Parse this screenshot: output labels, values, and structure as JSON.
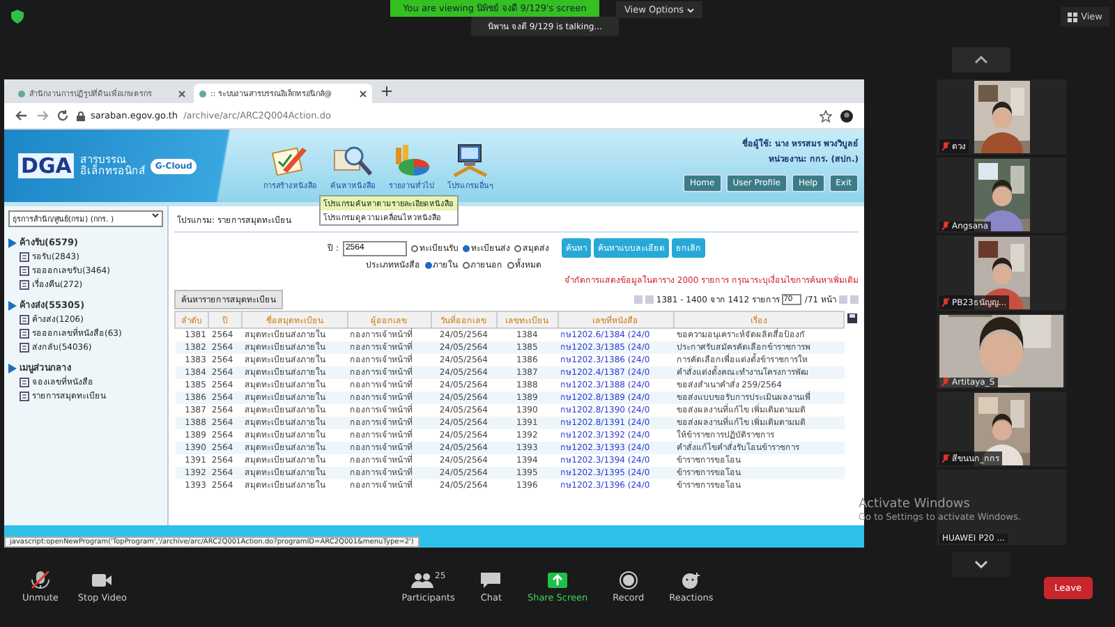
{
  "meeting": {
    "banner": "You are viewing นิพิชย์ จงดี 9/129's screen",
    "view_options": "View Options",
    "talking": "นิพาน จงดี 9/129 is talking...",
    "view_button": "View"
  },
  "browser": {
    "tabs": [
      {
        "title": "สำนักงานการปฏิรูปที่ดินเพื่อเกษตรกร",
        "selected": false
      },
      {
        "title": ":: ระบบงานสารบรรณอิเล็กทรอนิกส์@",
        "selected": true
      }
    ],
    "url_host": "saraban.egov.go.th",
    "url_path": "/archive/arc/ARC2Q004Action.do",
    "status_text": "javascript:openNewProgram('TopProgram','/archive/arc/ARC2Q001Action.do?programID=ARC2Q001&menuType=2')"
  },
  "app": {
    "logo": {
      "brand": "DGA",
      "line1": "สารบรรณ",
      "line2": "อิเล็กทรอนิกส์",
      "cloud": "G-Cloud"
    },
    "menu": [
      {
        "label": "การสร้างหนังสือ",
        "kind": "create"
      },
      {
        "label": "ค้นหาหนังสือ",
        "kind": "search"
      },
      {
        "label": "รายงานทั่วไป",
        "kind": "report"
      },
      {
        "label": "โปรแกรมอื่นๆ",
        "kind": "other"
      }
    ],
    "user": "ชื่อผู้ใช้: นาง หรรสมร พวงวิบูลย์",
    "unit": "หน่วยงาน: กกร. (สปก.)",
    "top_buttons": [
      "Home",
      "User Profile",
      "Help",
      "Exit"
    ],
    "dropdown": [
      {
        "label": "โปรแกรมค้นหาตามรายละเอียดหนังสือ",
        "selected": true
      },
      {
        "label": "โปรแกรมดูความเคลื่อนไหวหนังสือ",
        "selected": false
      }
    ],
    "department": "ธุรการสำนัก/ศูนย์(กรม) (กกร. )",
    "tree": [
      {
        "label": "ค้างรับ(6579)",
        "children": [
          {
            "label": "รอรับ(2843)"
          },
          {
            "label": "รอออกเลขรับ(3464)"
          },
          {
            "label": "เรื่องคืน(272)"
          }
        ]
      },
      {
        "label": "ค้างส่ง(55305)",
        "children": [
          {
            "label": "ค้างส่ง(1206)"
          },
          {
            "label": "รอออกเลขที่หนังสือ(63)"
          },
          {
            "label": "ส่งกลับ(54036)"
          }
        ]
      },
      {
        "label": "เมนูส่วนกลาง",
        "children": [
          {
            "label": "จองเลขที่หนังสือ"
          },
          {
            "label": "รายการสมุดทะเบียน"
          }
        ]
      }
    ],
    "program_title": "โปรแกรม: รายการสมุดทะเบียน",
    "form": {
      "year_label": "ปี :",
      "year_value": "2564",
      "register_types": [
        {
          "label": "ทะเบียนรับ",
          "selected": false
        },
        {
          "label": "ทะเบียนส่ง",
          "selected": true
        },
        {
          "label": "สมุดส่ง",
          "selected": false
        }
      ],
      "buttons": [
        "ค้นหา",
        "ค้นหาแบบละเอียด",
        "ยกเลิก"
      ],
      "doc_type_label": "ประเภทหนังสือ",
      "doc_types": [
        {
          "label": "ภายใน",
          "selected": true
        },
        {
          "label": "ภายนอก",
          "selected": false
        },
        {
          "label": "ทั้งหมด",
          "selected": false
        }
      ],
      "notice": "จำกัดการแสดงข้อมูลในตาราง 2000 รายการ กรุณาระบุเงื่อนไขการค้นหาเพิ่มเติม"
    },
    "grid": {
      "caption": "ค้นหารายการสมุดทะเบียน",
      "pager": "1381 - 1400 จาก 1412 รายการ",
      "page": "70",
      "page_total": "/71 หน้า",
      "columns": [
        "ลำดับ",
        "ปี",
        "ชื่อสมุดทะเบียน",
        "ผู้ออกเลข",
        "วันที่ออกเลข",
        "เลขทะเบียน",
        "เลขที่หนังสือ",
        "เรื่อง"
      ],
      "rows": [
        [
          "1381",
          "2564",
          "สมุดทะเบียนส่งภายใน",
          "กองการเจ้าหน้าที่",
          "24/05/2564",
          "1384",
          "กษ1202.6/1384 (24/0",
          "ขอความอนุเคราะห์จัดผลิตสื่อป้องกั"
        ],
        [
          "1382",
          "2564",
          "สมุดทะเบียนส่งภายใน",
          "กองการเจ้าหน้าที่",
          "24/05/2564",
          "1385",
          "กษ1202.3/1385 (24/0",
          "ประกาศรับสมัครคัดเลือกข้าราชการพ"
        ],
        [
          "1383",
          "2564",
          "สมุดทะเบียนส่งภายใน",
          "กองการเจ้าหน้าที่",
          "24/05/2564",
          "1386",
          "กษ1202.3/1386 (24/0",
          "การคัดเลือกเพื่อแต่งตั้งข้าราชการให"
        ],
        [
          "1384",
          "2564",
          "สมุดทะเบียนส่งภายใน",
          "กองการเจ้าหน้าที่",
          "24/05/2564",
          "1387",
          "กษ1202.4/1387 (24/0",
          "คำสั่งแต่งตั้งคณะทำงานโครงการพัฒ"
        ],
        [
          "1385",
          "2564",
          "สมุดทะเบียนส่งภายใน",
          "กองการเจ้าหน้าที่",
          "24/05/2564",
          "1388",
          "กษ1202.3/1388 (24/0",
          "ขอส่งสำเนาคำสั่ง 259/2564"
        ],
        [
          "1386",
          "2564",
          "สมุดทะเบียนส่งภายใน",
          "กองการเจ้าหน้าที่",
          "24/05/2564",
          "1389",
          "กษ1202.8/1389 (24/0",
          "ขอส่งแบบขอรับการประเมินผลงานเพื่"
        ],
        [
          "1387",
          "2564",
          "สมุดทะเบียนส่งภายใน",
          "กองการเจ้าหน้าที่",
          "24/05/2564",
          "1390",
          "กษ1202.8/1390 (24/0",
          "ขอส่งผลงานที่แก้ไข เพิ่มเติมตามมติ"
        ],
        [
          "1388",
          "2564",
          "สมุดทะเบียนส่งภายใน",
          "กองการเจ้าหน้าที่",
          "24/05/2564",
          "1391",
          "กษ1202.8/1391 (24/0",
          "ขอส่งผลงานที่แก้ไข เพิ่มเติมตามมติ"
        ],
        [
          "1389",
          "2564",
          "สมุดทะเบียนส่งภายใน",
          "กองการเจ้าหน้าที่",
          "24/05/2564",
          "1392",
          "กษ1202.3/1392 (24/0",
          "ให้ข้าราชการปฏิบัติราชการ"
        ],
        [
          "1390",
          "2564",
          "สมุดทะเบียนส่งภายใน",
          "กองการเจ้าหน้าที่",
          "24/05/2564",
          "1393",
          "กษ1202.3/1393 (24/0",
          "คำสั่งแก้ไขคำสั่งรับโอนข้าราชการ"
        ],
        [
          "1391",
          "2564",
          "สมุดทะเบียนส่งภายใน",
          "กองการเจ้าหน้าที่",
          "24/05/2564",
          "1394",
          "กษ1202.3/1394 (24/0",
          "ข้าราชการขอโอน"
        ],
        [
          "1392",
          "2564",
          "สมุดทะเบียนส่งภายใน",
          "กองการเจ้าหน้าที่",
          "24/05/2564",
          "1395",
          "กษ1202.3/1395 (24/0",
          "ข้าราชการขอโอน"
        ],
        [
          "1393",
          "2564",
          "สมุดทะเบียนส่งภายใน",
          "กองการเจ้าหน้าที่",
          "24/05/2564",
          "1396",
          "กษ1202.3/1396 (24/0",
          "ข้าราชการขอโอน"
        ]
      ]
    }
  },
  "participants": [
    {
      "name": "ดวง",
      "kind": "narrow",
      "muted": true
    },
    {
      "name": "Angsana",
      "kind": "narrow",
      "muted": true
    },
    {
      "name": "PB23ธนัญญ...",
      "kind": "narrow",
      "muted": true
    },
    {
      "name": "Artitaya_S",
      "kind": "wide",
      "muted": true
    },
    {
      "name": "สีขนนก_กกร",
      "kind": "narrow",
      "muted": true
    },
    {
      "name": "HUAWEI P20 ...",
      "kind": "none",
      "muted": false
    }
  ],
  "windows_notice": {
    "title": "Activate Windows",
    "subtitle": "Go to Settings to activate Windows."
  },
  "toolbar": {
    "left": [
      {
        "label": "Unmute",
        "kind": "mic"
      },
      {
        "label": "Stop Video",
        "kind": "video"
      }
    ],
    "center": [
      {
        "label": "Participants",
        "kind": "people",
        "count": "25"
      },
      {
        "label": "Chat",
        "kind": "chat"
      },
      {
        "label": "Share Screen",
        "kind": "share"
      },
      {
        "label": "Record",
        "kind": "record"
      },
      {
        "label": "Reactions",
        "kind": "reactions"
      }
    ],
    "leave": "Leave"
  }
}
